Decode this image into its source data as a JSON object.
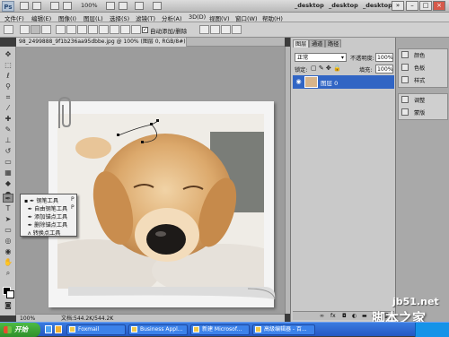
{
  "app": {
    "logo": "Ps",
    "zoom": "100%",
    "workspaces": [
      "_desktop",
      "_desktop",
      "_desktop"
    ]
  },
  "menu": [
    "文件(F)",
    "编辑(E)",
    "图像(I)",
    "图层(L)",
    "选择(S)",
    "滤镜(T)",
    "分析(A)",
    "3D(D)",
    "视图(V)",
    "窗口(W)",
    "帮助(H)"
  ],
  "options": {
    "auto_add_label": "自动添加/删除",
    "auto_add_checked": true
  },
  "document": {
    "tab_title": "98_2499888_9f1b236aa95dbbe.jpg @ 100% (图层 0, RGB/8#)",
    "close": "×"
  },
  "pen_flyout": {
    "items": [
      {
        "label": "钢笔工具",
        "key": "P"
      },
      {
        "label": "自由钢笔工具",
        "key": "P"
      },
      {
        "label": "添加锚点工具",
        "key": ""
      },
      {
        "label": "删除锚点工具",
        "key": ""
      },
      {
        "label": "转换点工具",
        "key": ""
      }
    ]
  },
  "status": {
    "zoom": "100%",
    "doc": "文档:544.2K/544.2K"
  },
  "layers_panel": {
    "tabs": [
      "图层",
      "通道",
      "路径"
    ],
    "blend_mode": "正常",
    "opacity_label": "不透明度:",
    "opacity": "100%",
    "lock_label": "锁定:",
    "fill_label": "填充:",
    "fill": "100%",
    "layer_name": "图层 0"
  },
  "dock": {
    "group1": [
      "颜色",
      "色板",
      "样式"
    ],
    "group2": [
      "调整",
      "蒙版"
    ]
  },
  "taskbar": {
    "start": "开始",
    "tasks": [
      "Foxmail",
      "Business Appl...",
      "新建 Microsof...",
      "高级编辑器 - 百..."
    ]
  },
  "watermark": {
    "domain": "jb51.net",
    "text": "脚本之家"
  },
  "colors": {
    "selection_blue": "#3165c4",
    "taskbar": "#2457c3"
  }
}
